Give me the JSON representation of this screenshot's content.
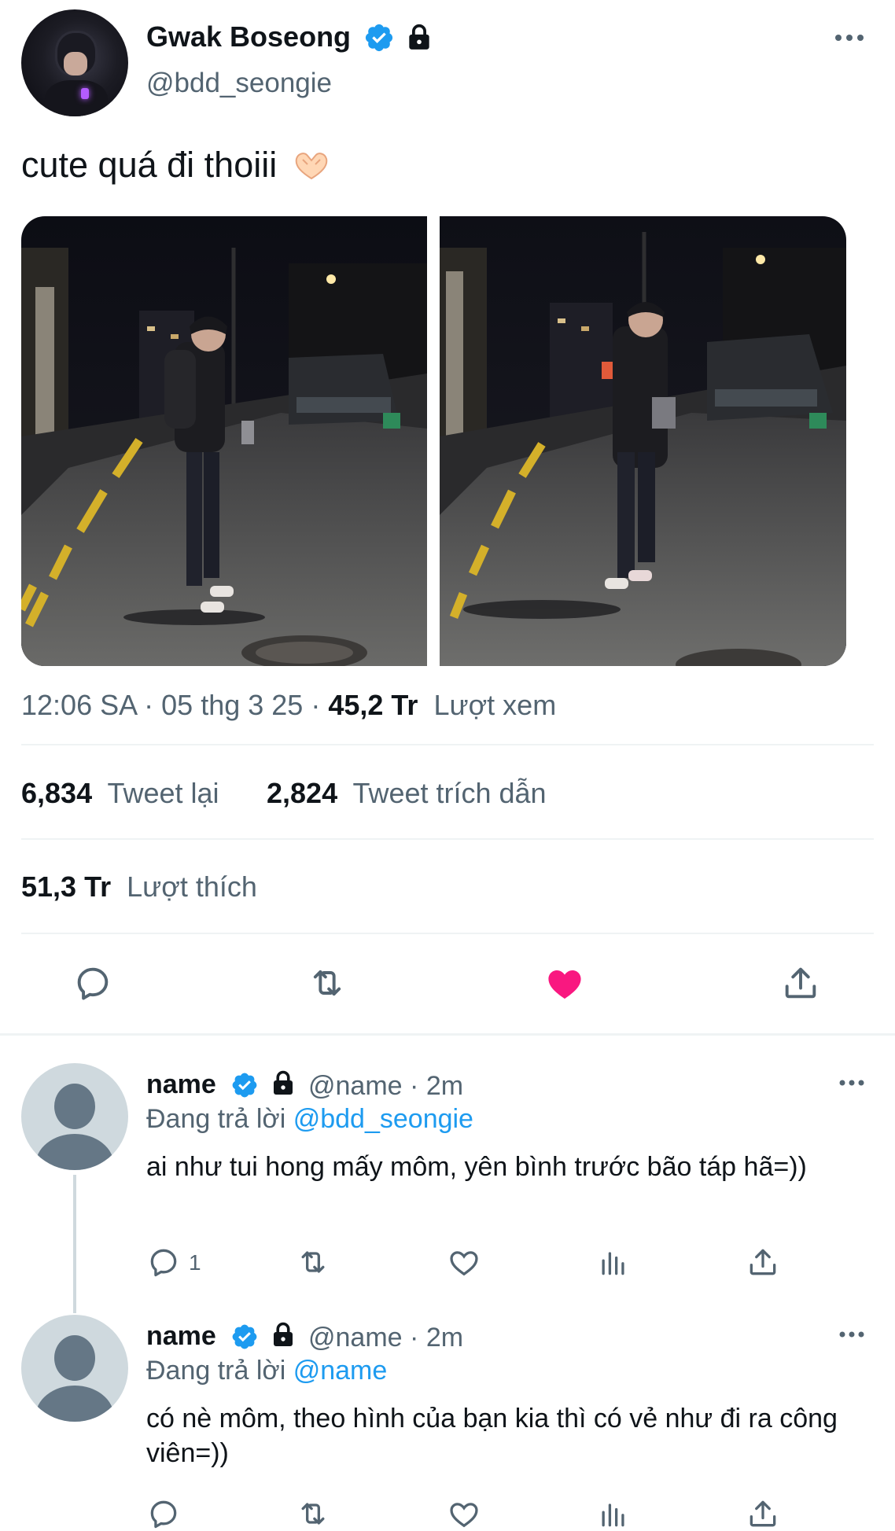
{
  "tweet": {
    "display_name": "Gwak Boseong",
    "handle": "@bdd_seongie",
    "text": "cute quá đi thoiii",
    "emoji": "heart-hands-emoji",
    "time": "12:06 SA",
    "date": "05 thg 3 25",
    "views_value": "45,2 Tr",
    "views_label": "Lượt xem",
    "retweets_value": "6,834",
    "retweets_label": "Tweet lại",
    "quotes_value": "2,824",
    "quotes_label": "Tweet trích dẫn",
    "likes_value": "51,3 Tr",
    "likes_label": "Lượt thích",
    "liked": true
  },
  "colors": {
    "text": "#0f1419",
    "secondary": "#536471",
    "link": "#1d9bf0",
    "like": "#f91880",
    "divider": "#eff3f4"
  },
  "actions": [
    "reply-icon",
    "retweet-icon",
    "like-icon",
    "share-icon"
  ],
  "replies": [
    {
      "name": "name",
      "handle": "@name",
      "time": "2m",
      "replying_prefix": "Đang trả lời",
      "replying_to": "@bdd_seongie",
      "text": "ai như tui hong mấy môm, yên bình trước bão táp hã=))",
      "reply_count": "1"
    },
    {
      "name": "name",
      "handle": "@name",
      "time": "2m",
      "replying_prefix": "Đang trả lời",
      "replying_to": "@name",
      "text": "có nè môm, theo hình của bạn kia thì có vẻ như đi ra công viên=))"
    }
  ]
}
